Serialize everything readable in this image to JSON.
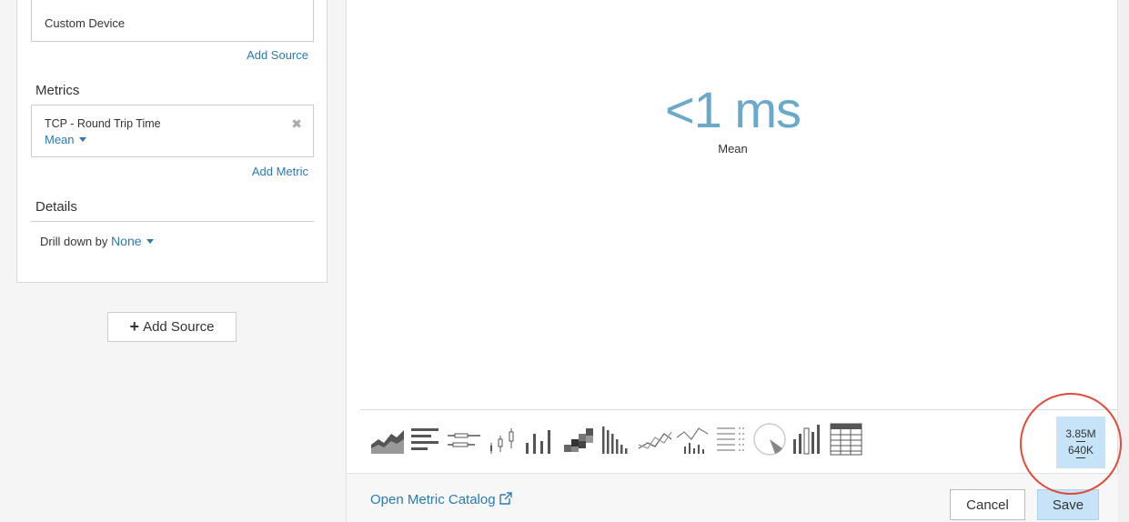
{
  "sources": {
    "device_name": "Custom Device",
    "add_source_link": "Add Source"
  },
  "metrics": {
    "title": "Metrics",
    "item": {
      "name": "TCP - Round Trip Time",
      "aggregation": "Mean",
      "remove_icon": "close-icon"
    },
    "add_metric_link": "Add Metric"
  },
  "details": {
    "title": "Details",
    "drill_label": "Drill down by",
    "drill_value": "None"
  },
  "add_source_button": {
    "plus": "+",
    "label": "Add Source"
  },
  "preview": {
    "value": "<1 ms",
    "caption": "Mean"
  },
  "chart_types": [
    "area-chart-icon",
    "bar-chart-icon",
    "box-plot-icon",
    "candlestick-icon",
    "column-chart-icon",
    "heatmap-icon",
    "histogram-icon",
    "line-chart-icon",
    "line-column-chart-icon",
    "list-icon",
    "pie-chart-icon",
    "status-chart-icon",
    "table-icon",
    "value-chart-icon"
  ],
  "selected_chart": {
    "line1": "3.85M",
    "line2": "640K"
  },
  "accent_color": "#2a7ab0",
  "value_color": "#69a9c9",
  "highlight_color": "#e34a3a",
  "footer": {
    "open_catalog": "Open Metric Catalog",
    "cancel": "Cancel",
    "save": "Save"
  }
}
